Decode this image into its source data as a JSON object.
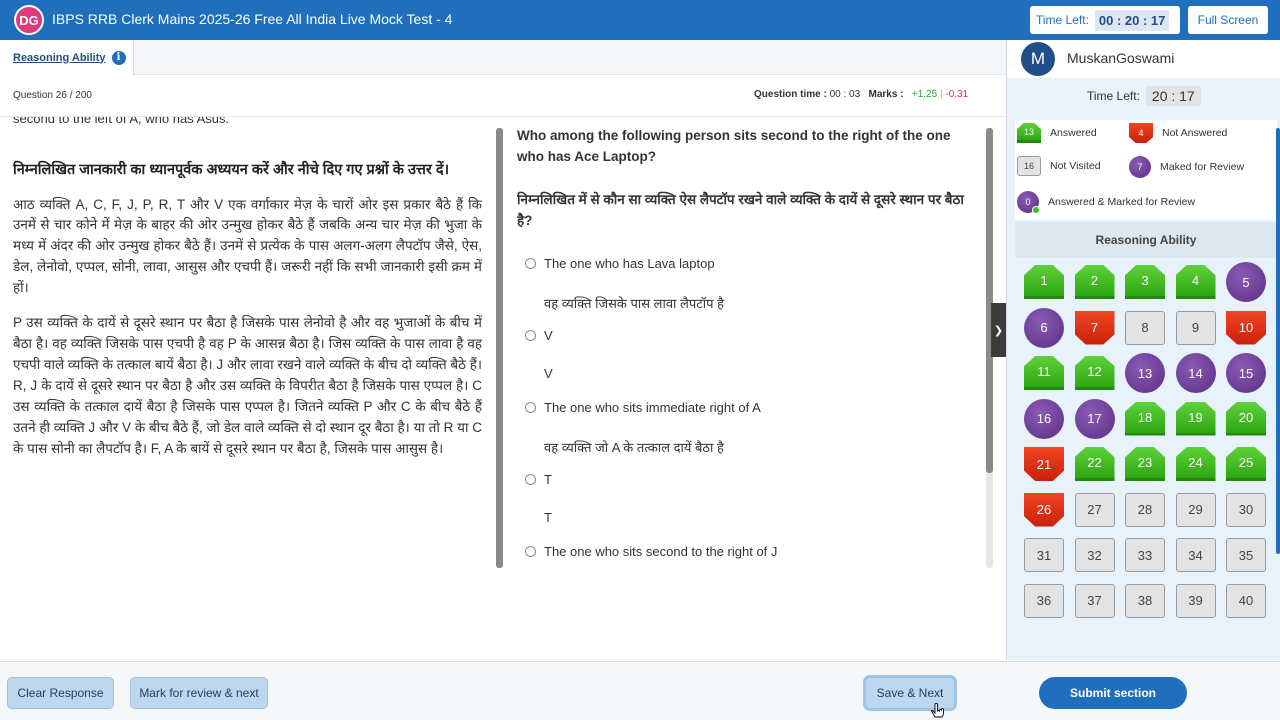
{
  "header": {
    "logo_text": "DG",
    "title": "IBPS RRB Clerk Mains 2025-26 Free All India Live Mock Test - 4",
    "time_left_label": "Time Left:",
    "time_left_value": "00 : 20 : 17",
    "fullscreen_label": "Full Screen"
  },
  "section_tab": {
    "label": "Reasoning Ability",
    "info_icon": "i"
  },
  "question_info": {
    "question_number": "Question 26 / 200",
    "question_time_label": "Question time :",
    "question_time_value": "00 : 03",
    "marks_label": "Marks :",
    "marks_positive": "+1.25",
    "marks_separator": "|",
    "marks_negative": "-0.31"
  },
  "passage": {
    "cut_text": "second to the left of A, who has Asus.",
    "heading": "निम्नलिखित जानकारी का ध्यानपूर्वक अध्ययन करें और नीचे दिए गए प्रश्नों के उत्तर दें।",
    "para1": "आठ व्यक्ति A, C, F, J, P, R, T और V एक वर्गाकार मेज़ के चारों ओर इस प्रकार बैठे हैं कि उनमें से चार कोने में मेज़ के बाहर की ओर उन्मुख होकर बैठे हैं जबकि अन्य चार मेज़ की भुजा के मध्य में अंदर की ओर उन्मुख होकर बैठे हैं। उनमें से प्रत्येक के पास अलग-अलग लैपटॉप जैसे, ऐस, डेल, लेनोवो, एप्पल, सोनी, लावा, आसुस और एचपी हैं। जरूरी नहीं कि सभी जानकारी इसी क्रम में हों।",
    "para2": "P उस व्यक्ति के दायें से दूसरे स्थान पर बैठा है जिसके पास लेनोवो है और वह भुजाओं के बीच में बैठा है। वह व्यक्ति जिसके पास एचपी है वह P के आसन्न बैठा है। जिस व्यक्ति के पास लावा है वह एचपी वाले व्यक्ति के तत्काल बायें बैठा है। J और लावा रखने वाले व्यक्ति के बीच दो व्यक्ति बैठे हैं। R, J के दायें से दूसरे स्थान पर बैठा है और उस व्यक्ति के विपरीत बैठा है जिसके पास एप्पल है। C उस व्यक्ति के तत्काल दायें बैठा है जिसके पास एप्पल है। जितने व्यक्ति P और C के बीच बैठे हैं उतने ही व्यक्ति J और V के बीच बैठे हैं, जो डेल वाले व्यक्ति से दो स्थान दूर बैठा है। या तो R या C के पास सोनी का लैपटॉप है। F, A के बायें से दूसरे स्थान पर बैठा है, जिसके पास आसुस है।"
  },
  "question": {
    "text_en": "Who among the following person sits second to the right of the one who has Ace Laptop?",
    "text_hi": "निम्नलिखित में से कौन सा व्यक्ति ऐस लैपटॉप रखने वाले व्यक्ति के दायें से दूसरे स्थान पर बैठा है?",
    "options": [
      {
        "en": "The one who has Lava laptop",
        "hi": "वह व्यक्ति जिसके पास लावा लैपटॉप है"
      },
      {
        "en": "V",
        "hi": "V"
      },
      {
        "en": "The one who sits immediate right of A",
        "hi": "वह व्यक्ति जो A के तत्काल दायें बैठा है"
      },
      {
        "en": "T",
        "hi": "T"
      },
      {
        "en": "The one who sits second to the right of J",
        "hi": ""
      }
    ]
  },
  "sidebar": {
    "avatar_letter": "M",
    "user_name": "MuskanGoswami",
    "time_left_label": "Time Left:",
    "time_left_value": "20 : 17",
    "legend": {
      "answered_count": "13",
      "answered_label": "Answered",
      "not_answered_count": "4",
      "not_answered_label": "Not Answered",
      "not_visited_count": "16",
      "not_visited_label": "Not Visited",
      "marked_count": "7",
      "marked_label": "Maked for Review",
      "ans_marked_count": "0",
      "ans_marked_label": "Answered & Marked for Review"
    },
    "section_title": "Reasoning Ability",
    "questions": [
      {
        "n": "1",
        "s": "answered"
      },
      {
        "n": "2",
        "s": "answered"
      },
      {
        "n": "3",
        "s": "answered"
      },
      {
        "n": "4",
        "s": "answered"
      },
      {
        "n": "5",
        "s": "review"
      },
      {
        "n": "6",
        "s": "review"
      },
      {
        "n": "7",
        "s": "not-answered"
      },
      {
        "n": "8",
        "s": "not-visited"
      },
      {
        "n": "9",
        "s": "not-visited"
      },
      {
        "n": "10",
        "s": "not-answered"
      },
      {
        "n": "11",
        "s": "answered"
      },
      {
        "n": "12",
        "s": "answered"
      },
      {
        "n": "13",
        "s": "review"
      },
      {
        "n": "14",
        "s": "review"
      },
      {
        "n": "15",
        "s": "review"
      },
      {
        "n": "16",
        "s": "review"
      },
      {
        "n": "17",
        "s": "review"
      },
      {
        "n": "18",
        "s": "answered"
      },
      {
        "n": "19",
        "s": "answered"
      },
      {
        "n": "20",
        "s": "answered"
      },
      {
        "n": "21",
        "s": "not-answered"
      },
      {
        "n": "22",
        "s": "answered"
      },
      {
        "n": "23",
        "s": "answered"
      },
      {
        "n": "24",
        "s": "answered"
      },
      {
        "n": "25",
        "s": "answered"
      },
      {
        "n": "26",
        "s": "not-answered"
      },
      {
        "n": "27",
        "s": "not-visited"
      },
      {
        "n": "28",
        "s": "not-visited"
      },
      {
        "n": "29",
        "s": "not-visited"
      },
      {
        "n": "30",
        "s": "not-visited"
      },
      {
        "n": "31",
        "s": "not-visited"
      },
      {
        "n": "32",
        "s": "not-visited"
      },
      {
        "n": "33",
        "s": "not-visited"
      },
      {
        "n": "34",
        "s": "not-visited"
      },
      {
        "n": "35",
        "s": "not-visited"
      },
      {
        "n": "36",
        "s": "not-visited"
      },
      {
        "n": "37",
        "s": "not-visited"
      },
      {
        "n": "38",
        "s": "not-visited"
      },
      {
        "n": "39",
        "s": "not-visited"
      },
      {
        "n": "40",
        "s": "not-visited"
      }
    ]
  },
  "footer": {
    "clear_label": "Clear Response",
    "mark_label": "Mark for review & next",
    "save_label": "Save & Next",
    "submit_label": "Submit section"
  },
  "colors": {
    "primary": "#1f6fbd",
    "answered": "#2ea613",
    "not_answered": "#d8290f",
    "review": "#6a3a96"
  }
}
